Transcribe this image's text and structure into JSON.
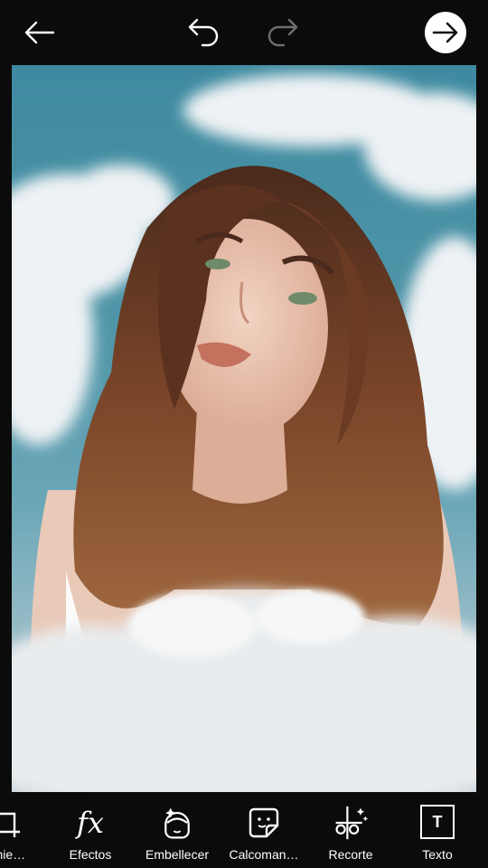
{
  "header": {
    "back_icon": "arrow-left-icon",
    "undo_icon": "undo-icon",
    "redo_icon": "redo-icon",
    "next_icon": "arrow-right-circle-icon"
  },
  "toolbar": {
    "items": [
      {
        "label": "amie…",
        "icon": "crop-icon"
      },
      {
        "label": "Efectos",
        "icon": "fx-icon",
        "glyph": "fx"
      },
      {
        "label": "Embellecer",
        "icon": "beautify-face-icon"
      },
      {
        "label": "Calcoman…",
        "icon": "sticker-icon"
      },
      {
        "label": "Recorte",
        "icon": "cutout-scissors-icon"
      },
      {
        "label": "Texto",
        "icon": "text-icon",
        "glyph": "T"
      }
    ]
  },
  "colors": {
    "background": "#0b0b0b",
    "sky": "#4f95a8",
    "cloud": "#eef1f3",
    "hair": "#6b3b22"
  }
}
